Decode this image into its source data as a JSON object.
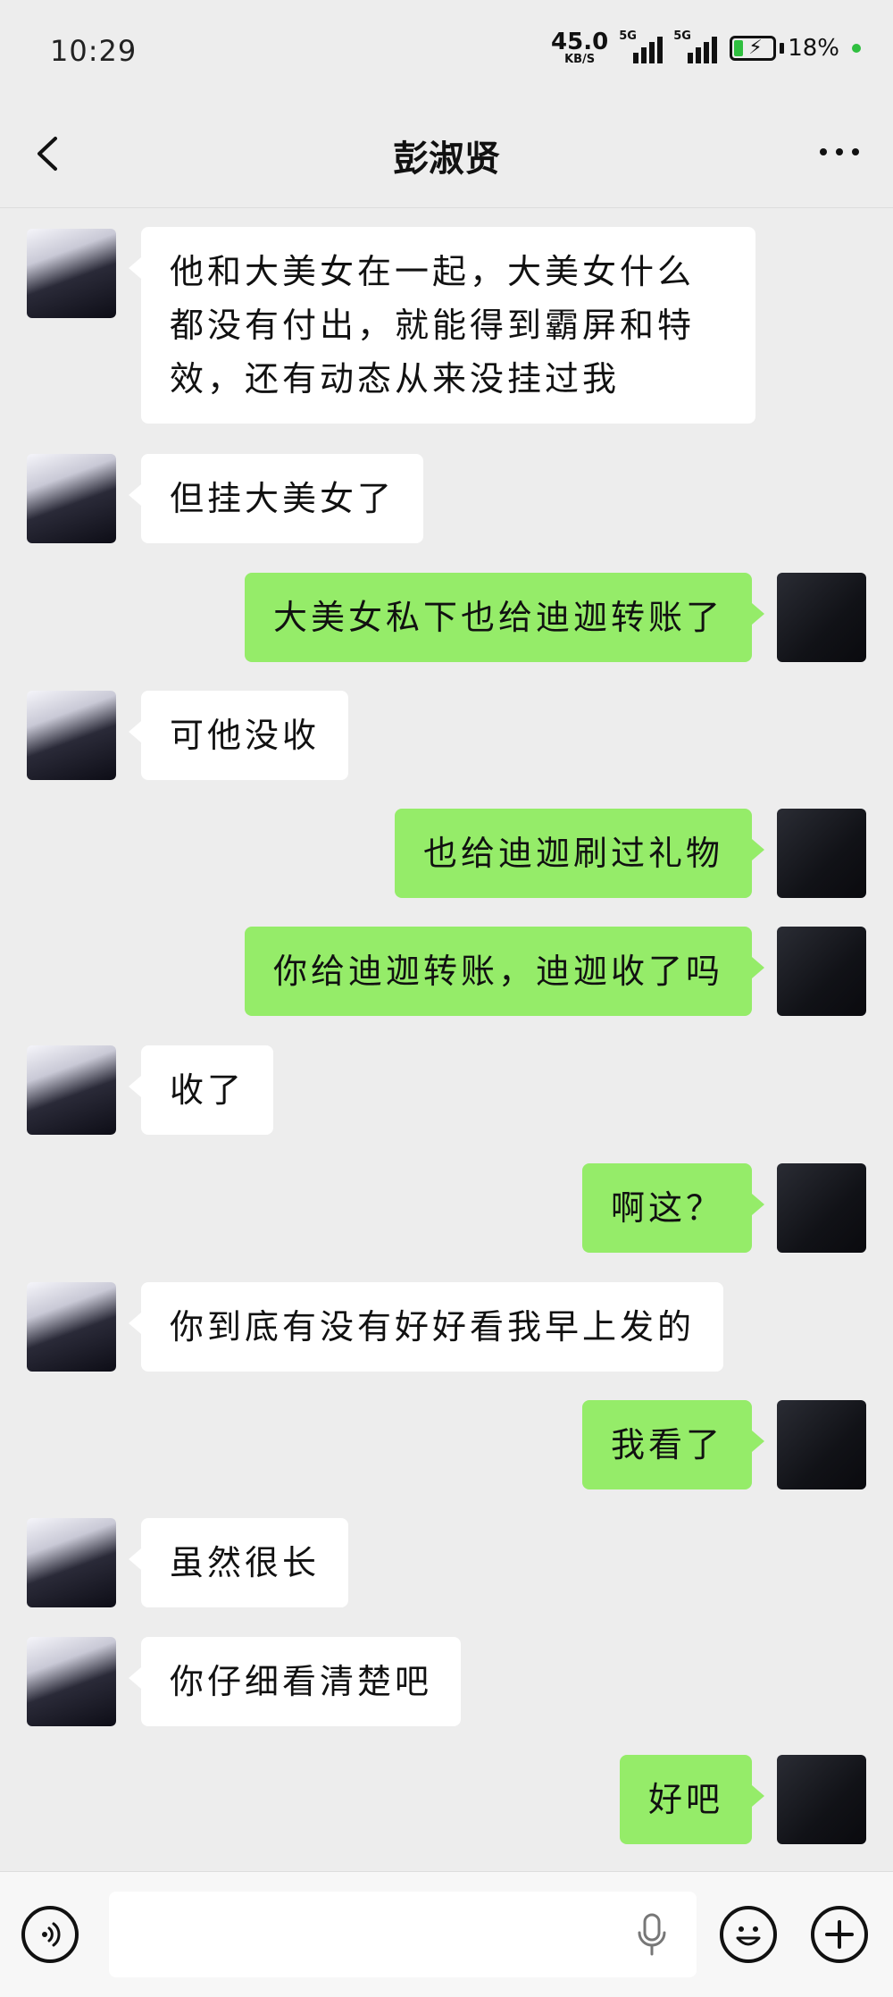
{
  "status": {
    "time": "10:29",
    "net_speed": "45.0",
    "net_unit": "KB/S",
    "signal1_label": "5G",
    "signal2_label": "5G",
    "battery": "18%"
  },
  "header": {
    "title": "彭淑贤"
  },
  "messages": [
    {
      "side": "in",
      "text": "他和大美女在一起，大美女什么都没有付出，就能得到霸屏和特效，还有动态从来没挂过我"
    },
    {
      "side": "in",
      "text": "但挂大美女了"
    },
    {
      "side": "out",
      "text": "大美女私下也给迪迦转账了"
    },
    {
      "side": "in",
      "text": "可他没收"
    },
    {
      "side": "out",
      "text": "也给迪迦刷过礼物"
    },
    {
      "side": "out",
      "text": "你给迪迦转账，迪迦收了吗"
    },
    {
      "side": "in",
      "text": "收了"
    },
    {
      "side": "out",
      "text": "啊这？"
    },
    {
      "side": "in",
      "text": "你到底有没有好好看我早上发的"
    },
    {
      "side": "out",
      "text": "我看了"
    },
    {
      "side": "in",
      "text": "虽然很长"
    },
    {
      "side": "in",
      "text": "你仔细看清楚吧"
    },
    {
      "side": "out",
      "text": "好吧"
    }
  ],
  "input": {
    "placeholder": ""
  },
  "icons": {
    "back": "back-arrow-icon",
    "more": "more-dots-icon",
    "voice": "voice-icon",
    "mic": "microphone-icon",
    "emoji": "emoji-icon",
    "plus": "plus-icon"
  },
  "colors": {
    "background": "#ededed",
    "incoming_bubble": "#ffffff",
    "outgoing_bubble": "#95ec69"
  }
}
